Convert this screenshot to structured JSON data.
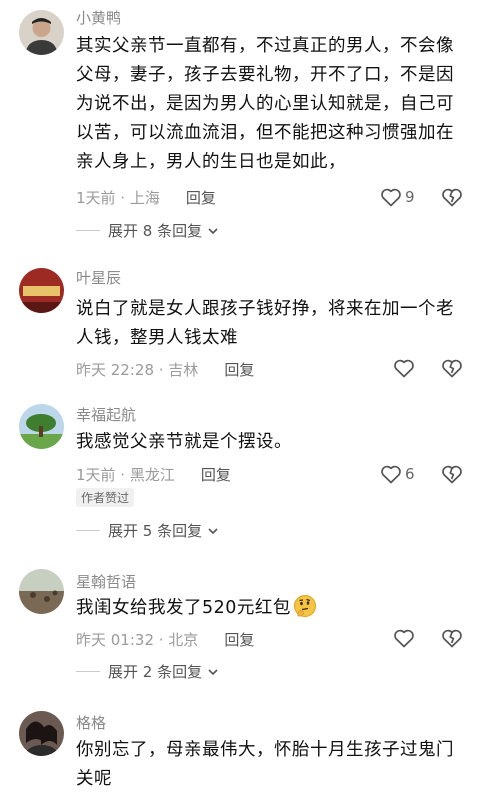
{
  "comments": [
    {
      "username": "小黄鸭",
      "lines": [
        "其实父亲节一直都有，不过真正的男人，不会像",
        "父母，妻子，孩子去要礼物，开不了口，不是因",
        "为说不出，是因为男人的心里认知就是，自己可",
        "以苦，可以流血流泪，但不能把这种习惯强加在",
        "亲人身上，男人的生日也是如此，"
      ],
      "time_location": "1天前 · 上海",
      "reply_label": "回复",
      "like_count": "9",
      "expand_label": "展开 8 条回复"
    },
    {
      "username": "叶星辰",
      "lines": [
        "说白了就是女人跟孩子钱好挣，将来在加一个老",
        "人钱，整男人钱太难"
      ],
      "time_location": "昨天 22:28 · 吉林",
      "reply_label": "回复",
      "like_count": ""
    },
    {
      "username": "幸福起航",
      "lines": [
        "我感觉父亲节就是个摆设。"
      ],
      "time_location": "1天前 · 黑龙江",
      "reply_label": "回复",
      "like_count": "6",
      "badge": "作者赞过",
      "expand_label": "展开 5 条回复"
    },
    {
      "username": "星翰哲语",
      "lines": [
        "我闺女给我发了520元红包"
      ],
      "time_location": "昨天 01:32 · 北京",
      "reply_label": "回复",
      "like_count": "",
      "expand_label": "展开 2 条回复"
    },
    {
      "username": "格格",
      "lines": [
        "你别忘了，母亲最伟大，怀胎十月生孩子过鬼门",
        "关呢"
      ]
    }
  ],
  "icons": {
    "like": "heart-outline-icon",
    "dislike": "broken-heart-icon",
    "expand": "chevron-down-icon",
    "emoji": "thinking-face-emoji"
  }
}
